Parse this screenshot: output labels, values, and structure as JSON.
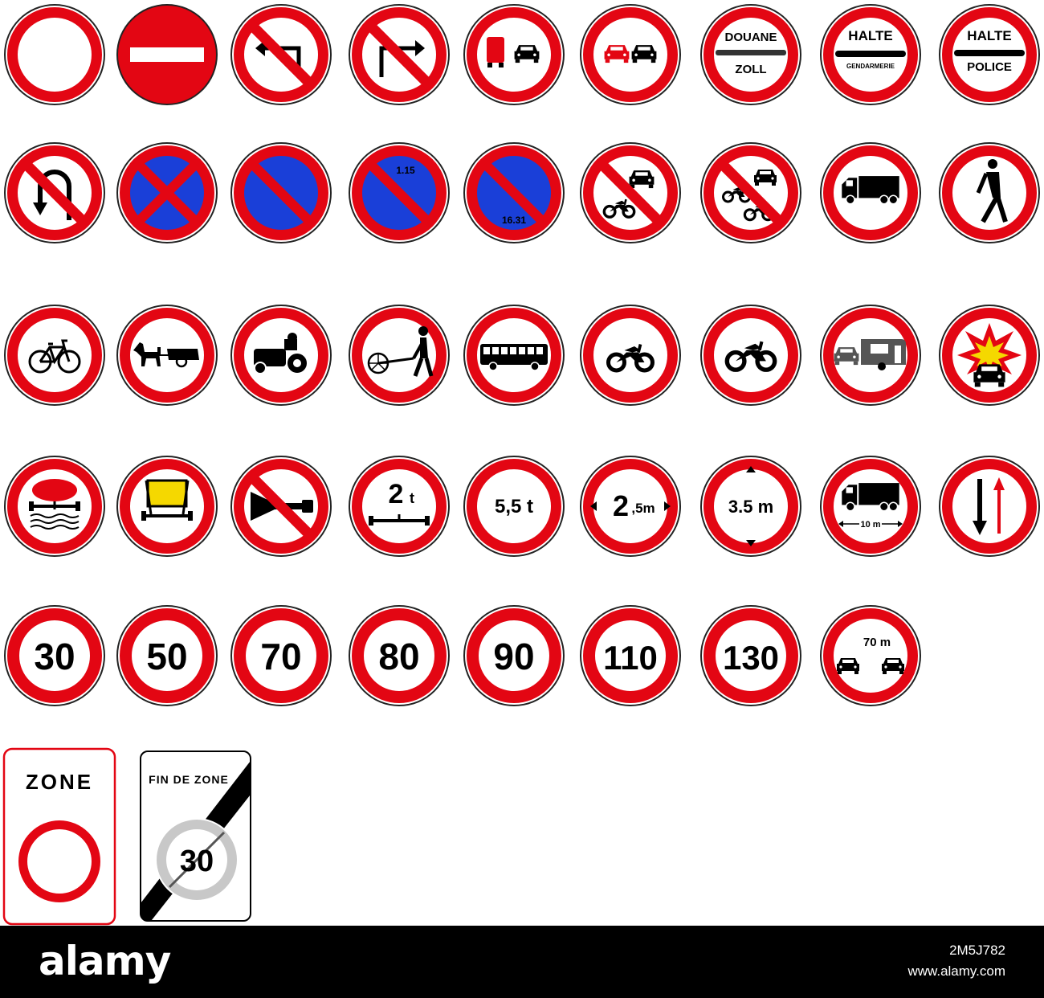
{
  "colors": {
    "red": "#e30613",
    "blue": "#1a3fd8",
    "black": "#000000",
    "white": "#ffffff",
    "yellow": "#f5d800",
    "grey": "#c8c8c8"
  },
  "rows": [
    [
      {
        "name": "no-entry-for-all-vehicles-sign",
        "icon": "empty-circle"
      },
      {
        "name": "no-entry-sign",
        "icon": "white-bar"
      },
      {
        "name": "no-left-turn-sign",
        "icon": "left-turn-arrow"
      },
      {
        "name": "no-right-turn-sign",
        "icon": "right-turn-arrow"
      },
      {
        "name": "no-overtaking-trucks-sign",
        "icon": "truck-and-car"
      },
      {
        "name": "no-overtaking-sign",
        "icon": "two-cars"
      },
      {
        "name": "customs-stop-sign",
        "icon": "customs-text"
      },
      {
        "name": "gendarmerie-stop-sign",
        "icon": "gendarmerie-text"
      },
      {
        "name": "police-stop-sign",
        "icon": "police-text"
      }
    ],
    [
      {
        "name": "no-u-turn-sign",
        "icon": "u-turn-arrow"
      },
      {
        "name": "no-stopping-sign",
        "icon": "blue-cross"
      },
      {
        "name": "no-parking-sign",
        "icon": "blue-slash"
      },
      {
        "name": "no-parking-first-half-sign",
        "icon": "blue-slash-top"
      },
      {
        "name": "no-parking-second-half-sign",
        "icon": "blue-slash-bottom"
      },
      {
        "name": "no-motor-vehicles-sign",
        "icon": "car-and-motorcycle"
      },
      {
        "name": "no-motor-vehicles-mopeds-sign",
        "icon": "car-moped-motorcycle"
      },
      {
        "name": "no-trucks-sign",
        "icon": "truck-icon"
      },
      {
        "name": "no-pedestrians-sign",
        "icon": "pedestrian-icon"
      }
    ],
    [
      {
        "name": "no-bicycles-sign",
        "icon": "bicycle-icon"
      },
      {
        "name": "no-horse-drawn-vehicles-sign",
        "icon": "horse-cart-icon"
      },
      {
        "name": "no-tractors-sign",
        "icon": "tractor-icon"
      },
      {
        "name": "no-handcarts-sign",
        "icon": "handcart-icon"
      },
      {
        "name": "no-buses-sign",
        "icon": "bus-icon"
      },
      {
        "name": "no-mopeds-sign",
        "icon": "moped-icon"
      },
      {
        "name": "no-motorcycles-sign",
        "icon": "motorcycle-icon"
      },
      {
        "name": "no-trailers-sign",
        "icon": "car-trailer-icon"
      },
      {
        "name": "no-explosives-sign",
        "icon": "explosion-icon"
      }
    ],
    [
      {
        "name": "no-water-pollutant-vehicles-sign",
        "icon": "tanker-water-icon"
      },
      {
        "name": "no-dangerous-goods-sign",
        "icon": "dangerous-goods-icon"
      },
      {
        "name": "no-horn-sign",
        "icon": "horn-icon"
      },
      {
        "name": "axle-weight-limit-sign",
        "icon": "axle-weight",
        "text": [
          "2",
          "t"
        ]
      },
      {
        "name": "weight-limit-sign",
        "icon": "weight-text",
        "text": [
          "5,5 t"
        ]
      },
      {
        "name": "width-limit-sign",
        "icon": "width-text",
        "text": [
          "2",
          ",5m"
        ]
      },
      {
        "name": "height-limit-sign",
        "icon": "height-text",
        "text": [
          "3.5 m"
        ]
      },
      {
        "name": "length-limit-sign",
        "icon": "truck-length",
        "text": [
          "10 m"
        ]
      },
      {
        "name": "priority-to-oncoming-traffic-sign",
        "icon": "oncoming-arrows"
      }
    ],
    [
      {
        "name": "speed-limit-30-sign",
        "icon": "speed",
        "text": [
          "30"
        ]
      },
      {
        "name": "speed-limit-50-sign",
        "icon": "speed",
        "text": [
          "50"
        ]
      },
      {
        "name": "speed-limit-70-sign",
        "icon": "speed",
        "text": [
          "70"
        ]
      },
      {
        "name": "speed-limit-80-sign",
        "icon": "speed",
        "text": [
          "80"
        ]
      },
      {
        "name": "speed-limit-90-sign",
        "icon": "speed",
        "text": [
          "90"
        ]
      },
      {
        "name": "speed-limit-110-sign",
        "icon": "speed",
        "text": [
          "110"
        ]
      },
      {
        "name": "speed-limit-130-sign",
        "icon": "speed",
        "text": [
          "130"
        ]
      },
      {
        "name": "minimum-distance-sign",
        "icon": "distance-cars",
        "text": [
          "70 m"
        ]
      }
    ]
  ],
  "texts": {
    "douane": "DOUANE",
    "zoll": "ZOLL",
    "halte": "HALTE",
    "gendarmerie": "GENDARMERIE",
    "police": "POLICE",
    "time1": "1.15",
    "time2": "16.31"
  },
  "zone_panel": {
    "label": "ZONE"
  },
  "end_zone_panel": {
    "label": "FIN DE ZONE",
    "speed": "30"
  },
  "footer": {
    "logo": "alamy",
    "image_id": "2M5J782",
    "site": "www.alamy.com"
  }
}
